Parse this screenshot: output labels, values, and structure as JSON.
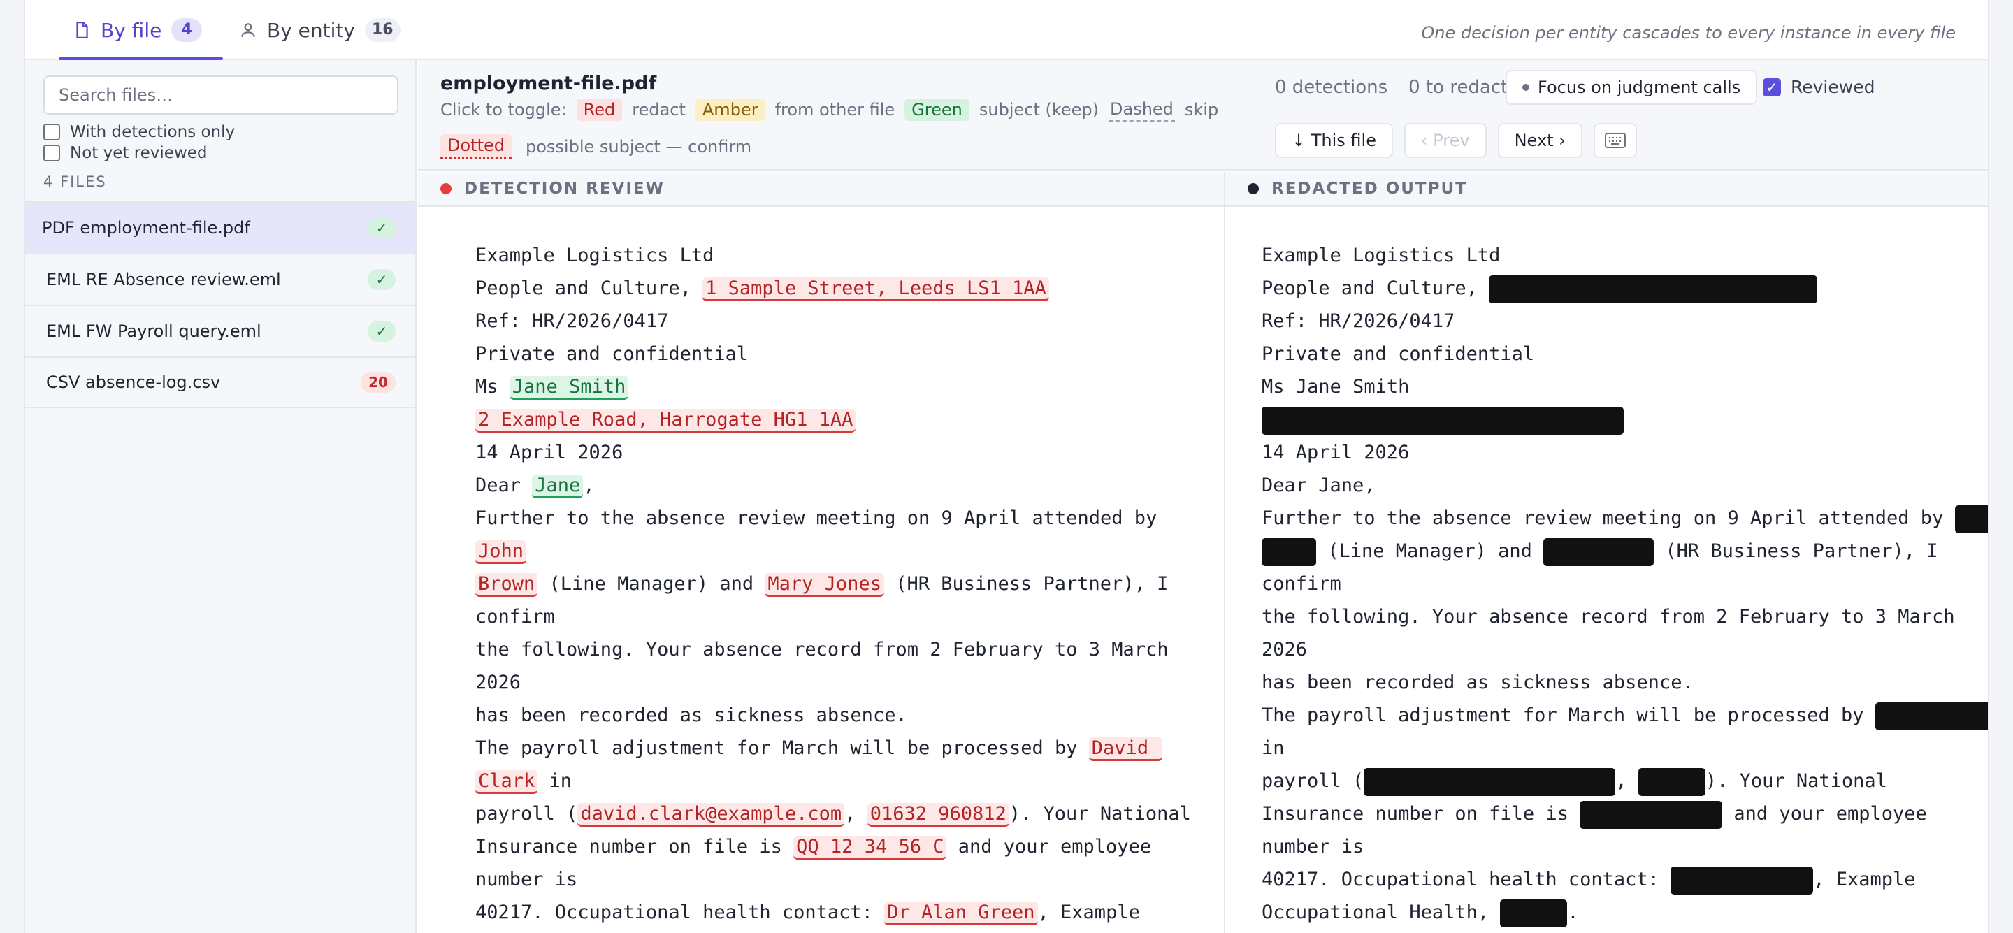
{
  "tabs": {
    "by_file": {
      "label": "By file",
      "count": "4"
    },
    "by_entity": {
      "label": "By entity",
      "count": "16"
    }
  },
  "tagline": "One decision per entity cascades to every instance in every file",
  "sidebar": {
    "search_placeholder": "Search files…",
    "filter_detections": "With detections only",
    "filter_unreviewed": "Not yet reviewed",
    "files_heading": "4 FILES",
    "files": [
      {
        "name": "PDF employment-file.pdf",
        "badge": "✓"
      },
      {
        "name": "EML RE Absence review.eml",
        "badge": "✓"
      },
      {
        "name": "EML FW Payroll query.eml",
        "badge": "✓"
      },
      {
        "name": "CSV absence-log.csv",
        "badge": "20"
      }
    ]
  },
  "header": {
    "file_name": "employment-file.pdf",
    "toggle_prefix": "Click to toggle:",
    "legend": {
      "red": "Red",
      "red_desc": "redact",
      "amber": "Amber",
      "amber_desc": "from other file",
      "green": "Green",
      "green_desc": "subject (keep)",
      "dashed": "Dashed",
      "dashed_desc": "skip",
      "dotted": "Dotted",
      "dotted_desc": "possible subject — confirm"
    },
    "detections": "0 detections",
    "to_redact": "0 to redact",
    "focus_label": "Focus on judgment calls",
    "reviewed_label": "Reviewed",
    "this_file": "↓ This file",
    "prev": "‹ Prev",
    "next": "Next ›"
  },
  "panes": {
    "review_title": "DETECTION REVIEW",
    "output_title": "REDACTED OUTPUT"
  },
  "document": {
    "company": "Example Logistics Ltd",
    "dept_prefix": "People and Culture, ",
    "dept_address": "1 Sample Street, Leeds LS1 1AA",
    "ref": "Ref: HR/2026/0417",
    "private": "Private and confidential",
    "ms": "Ms ",
    "subject_name": "Jane Smith",
    "subject_address": "2 Example Road, Harrogate HG1 1AA",
    "date": "14 April 2026",
    "dear": "Dear ",
    "first_name": "Jane",
    "comma": ",",
    "meeting_line": "Further to the absence review meeting on 9 April attended by ",
    "john": "John",
    "brown": "Brown",
    "line_mgr": " (Line Manager) and ",
    "mary": "Mary Jones",
    "hrbp": " (HR Business Partner), I",
    "confirm": "confirm",
    "absence_line": "the following. Your absence record from 2 February to 3 March",
    "year": "2026",
    "sickness": "has been recorded as sickness absence.",
    "payroll_line": "The payroll adjustment for March will be processed by ",
    "david": "David ",
    "clark": "Clark",
    "in": " in",
    "payroll_open": "payroll (",
    "email": "david.clark@example.com",
    "sep": ", ",
    "phone": "01632 960812",
    "national": "). Your National",
    "ni_prefix": "Insurance number on file is ",
    "ni": "QQ 12 34 56 C",
    "employee": " and your employee",
    "number_is": "number is",
    "oh_prefix": "40217. Occupational health contact: ",
    "doctor": "Dr Alan Green",
    "oh_suffix": ", Example",
    "oh_line2_prefix": "Occupational Health, ",
    "period": ".",
    "in_word": "in",
    "full_stop_comma": ", Example"
  },
  "colors": {
    "accent": "#5b4fe0",
    "redact_red": "#d63b3b",
    "keep_green": "#22a05a",
    "amber": "#fcefc5"
  }
}
